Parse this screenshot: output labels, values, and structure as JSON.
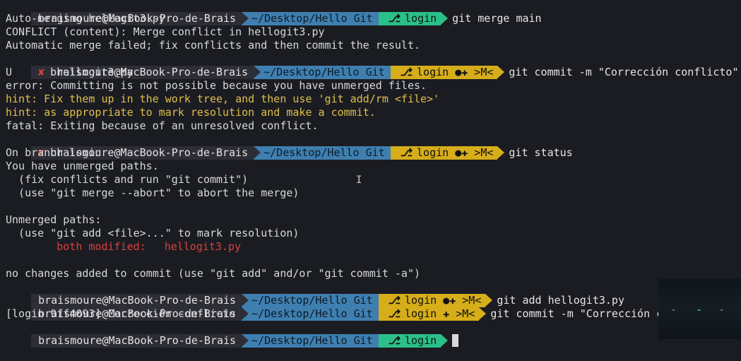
{
  "prompt": {
    "user": "braismoure@MacBook-Pro-de-Brais",
    "path": "~/Desktop/Hello Git",
    "error_icon": "✘",
    "branch_icon": "⎇"
  },
  "lines": {
    "l1": {
      "branch": "login",
      "command": "git merge main"
    },
    "l2": "Auto-merging hellogit3.py",
    "l3": "CONFLICT (content): Merge conflict in hellogit3.py",
    "l4": "Automatic merge failed; fix conflicts and then commit the result.",
    "l5": {
      "branch": "login ●✚ >M<",
      "command": "git commit -m \"Corrección conflicto\""
    },
    "l6": "U       hellogit3.py",
    "l7": "error: Committing is not possible because you have unmerged files.",
    "l8": "hint: Fix them up in the work tree, and then use 'git add/rm <file>'",
    "l9": "hint: as appropriate to mark resolution and make a commit.",
    "l10": "fatal: Exiting because of an unresolved conflict.",
    "l11": {
      "branch": "login ●✚ >M<",
      "command": "git status"
    },
    "l12": "On branch login",
    "l13": "You have unmerged paths.",
    "l14": "  (fix conflicts and run \"git commit\")",
    "l15": "  (use \"git merge --abort\" to abort the merge)",
    "l16": "Unmerged paths:",
    "l17": "  (use \"git add <file>...\" to mark resolution)",
    "l18_label": "        both modified:",
    "l18_file": "hellogit3.py",
    "l19": "no changes added to commit (use \"git add\" and/or \"git commit -a\")",
    "l20": {
      "branch": "login ●✚ >M<",
      "command": "git add hellogit3.py"
    },
    "l21": {
      "branch": "login ✚ >M<",
      "command": "git commit -m \"Corrección co"
    },
    "l22": "[login 9ff4093] Corrección conflicto",
    "l23": {
      "branch": "login",
      "command": ""
    }
  },
  "colors": {
    "background": "#1b1c22",
    "path_segment": "#3f7fb0",
    "branch_clean": "#2bc08a",
    "branch_dirty": "#d6ad1a",
    "hint": "#e0c04a",
    "conflict": "#d8413a"
  }
}
